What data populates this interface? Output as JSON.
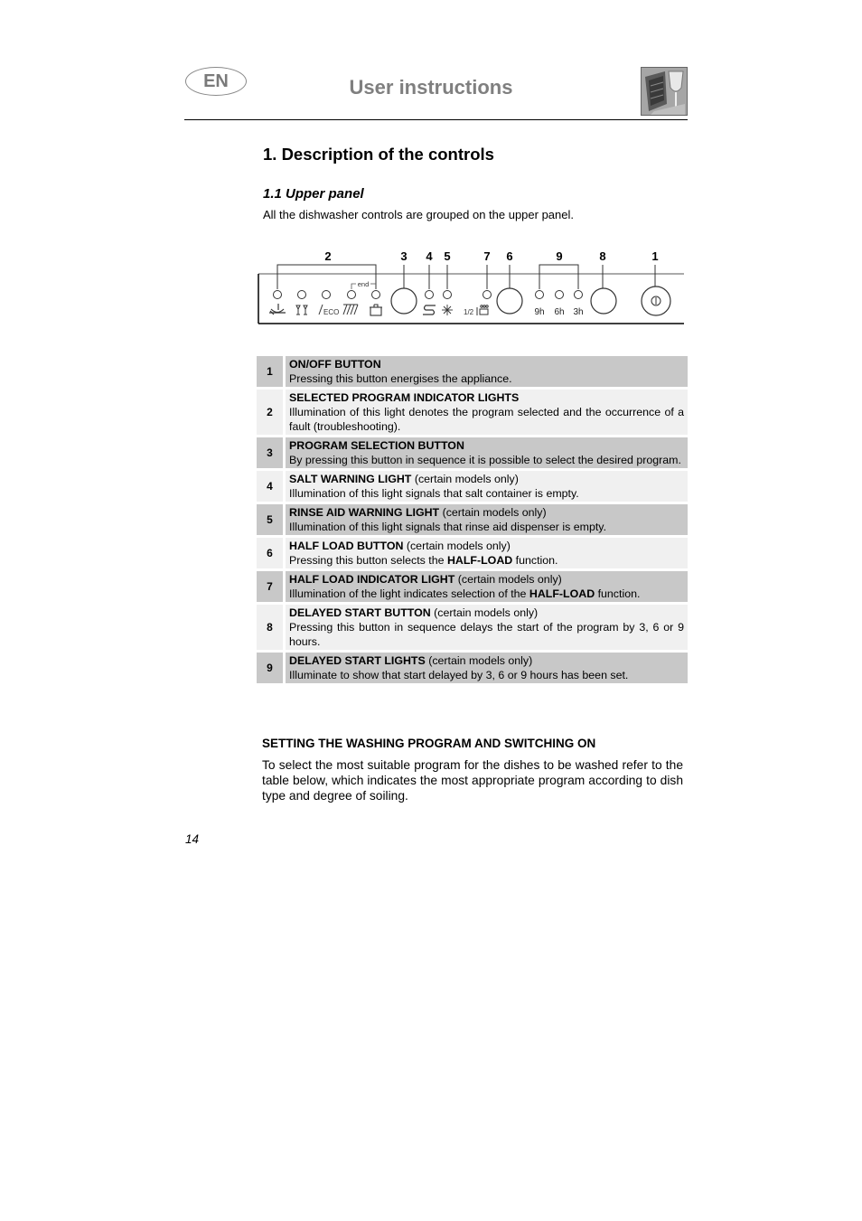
{
  "header": {
    "language_badge": "EN",
    "title": "User instructions",
    "image_icon": "dishwasher-glass-icon"
  },
  "section": {
    "heading": "1.  Description of the controls",
    "subheading": "1.1 Upper panel",
    "intro": "All the dishwasher controls are grouped on the upper panel."
  },
  "panel": {
    "callouts": [
      "2",
      "3",
      "4",
      "5",
      "7",
      "6",
      "9",
      "8",
      "1"
    ],
    "end_label": "end",
    "half_label": "1/2",
    "delay_labels": [
      "9h",
      "6h",
      "3h"
    ],
    "program_icons": [
      "soak-pan-icon",
      "glasses-icon",
      "eco-icon",
      "plates-icon",
      "pot-icon"
    ],
    "salt_icon": "salt-icon",
    "rinse_icon": "rinse-aid-icon",
    "half_load_icon": "half-load-icon",
    "power_icon": "power-icon"
  },
  "controls": [
    {
      "num": "1",
      "title": "ON/OFF BUTTON",
      "note": "",
      "desc": [
        {
          "t": "Pressing this button energises the appliance."
        }
      ],
      "shade": "dark"
    },
    {
      "num": "2",
      "title": "SELECTED PROGRAM INDICATOR LIGHTS",
      "note": "",
      "desc": [
        {
          "t": "Illumination of this light denotes the program selected and the occurrence of a fault (troubleshooting)."
        }
      ],
      "shade": "light"
    },
    {
      "num": "3",
      "title": "PROGRAM SELECTION BUTTON",
      "note": "",
      "desc": [
        {
          "t": "By pressing this button in sequence it is possible to select the desired program."
        }
      ],
      "shade": "dark"
    },
    {
      "num": "4",
      "title": "SALT WARNING LIGHT",
      "note": " (certain models only)",
      "desc": [
        {
          "t": "Illumination of this light signals that salt container is empty."
        }
      ],
      "shade": "light"
    },
    {
      "num": "5",
      "title": "RINSE AID WARNING LIGHT",
      "note": " (certain models only)",
      "desc": [
        {
          "t": "Illumination of this light signals that rinse aid dispenser is empty."
        }
      ],
      "shade": "dark"
    },
    {
      "num": "6",
      "title": "HALF LOAD BUTTON",
      "note": " (certain models only)",
      "desc": [
        {
          "t": "Pressing this button selects the "
        },
        {
          "t": "HALF-LOAD",
          "b": true
        },
        {
          "t": " function."
        }
      ],
      "shade": "light"
    },
    {
      "num": "7",
      "title": "HALF LOAD INDICATOR LIGHT",
      "note": " (certain models only)",
      "desc": [
        {
          "t": "Illumination of the light indicates selection of the "
        },
        {
          "t": "HALF-LOAD",
          "b": true
        },
        {
          "t": " function."
        }
      ],
      "shade": "dark"
    },
    {
      "num": "8",
      "title": "DELAYED START BUTTON",
      "note": " (certain models only)",
      "desc": [
        {
          "t": "Pressing this button in sequence delays the start of the program by 3, 6 or 9 hours."
        }
      ],
      "shade": "light"
    },
    {
      "num": "9",
      "title": "DELAYED START LIGHTS",
      "note": " (certain models only)",
      "desc": [
        {
          "t": "Illuminate to show that start delayed by 3, 6 or 9 hours has been set."
        }
      ],
      "shade": "dark"
    }
  ],
  "setting": {
    "heading": "SETTING THE WASHING PROGRAM AND SWITCHING ON",
    "paragraph": "To select the most suitable program for the dishes to be washed refer to the table below, which indicates the most appropriate program according to dish type and degree of soiling."
  },
  "footer": {
    "page_number": "14"
  }
}
